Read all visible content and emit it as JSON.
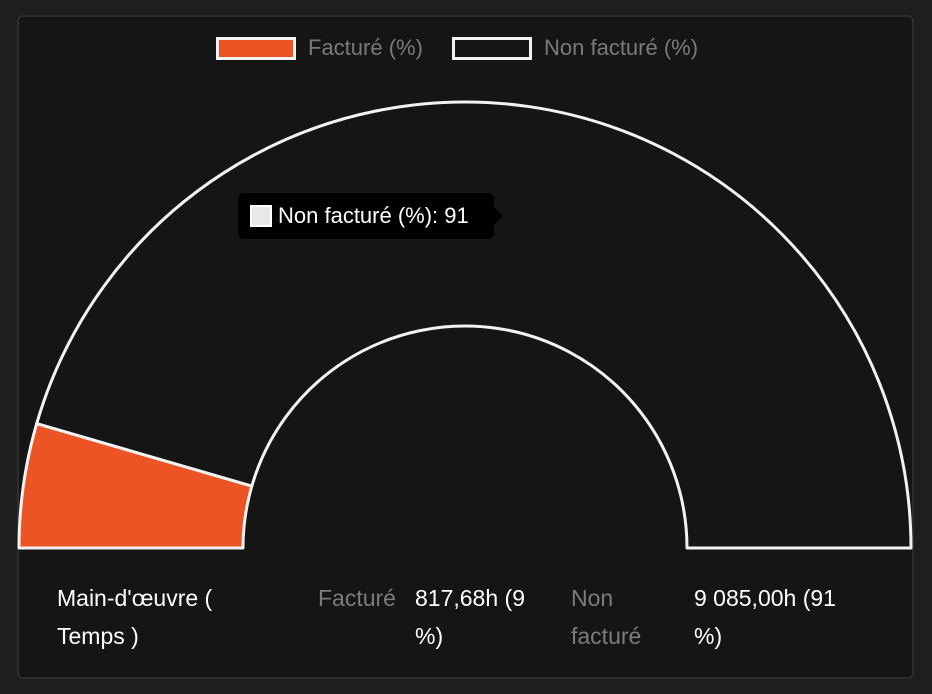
{
  "legend": [
    {
      "label": "Facturé (%)",
      "color": "#ed5425"
    },
    {
      "label": "Non facturé (%)",
      "color": "#151516"
    }
  ],
  "tooltip": {
    "text": "Non facturé (%): 91",
    "swatch_color": "#e8e8e8"
  },
  "footer": {
    "category_label": "Main-d'œuvre (\nTemps )",
    "facture_label": "Facturé",
    "facture_value": "817,68h (9\n%)",
    "non_facture_label": "Non\nfacturé",
    "non_facture_value": "9 085,00h (91\n%)"
  },
  "chart_data": {
    "type": "pie",
    "variant": "half-doughnut gauge",
    "title": "",
    "categories": [
      "Facturé (%)",
      "Non facturé (%)"
    ],
    "values": [
      9,
      91
    ],
    "colors": [
      "#ed5425",
      "#151516"
    ],
    "outline_color": "#f2f2f2",
    "legend_placement": "top-center"
  }
}
